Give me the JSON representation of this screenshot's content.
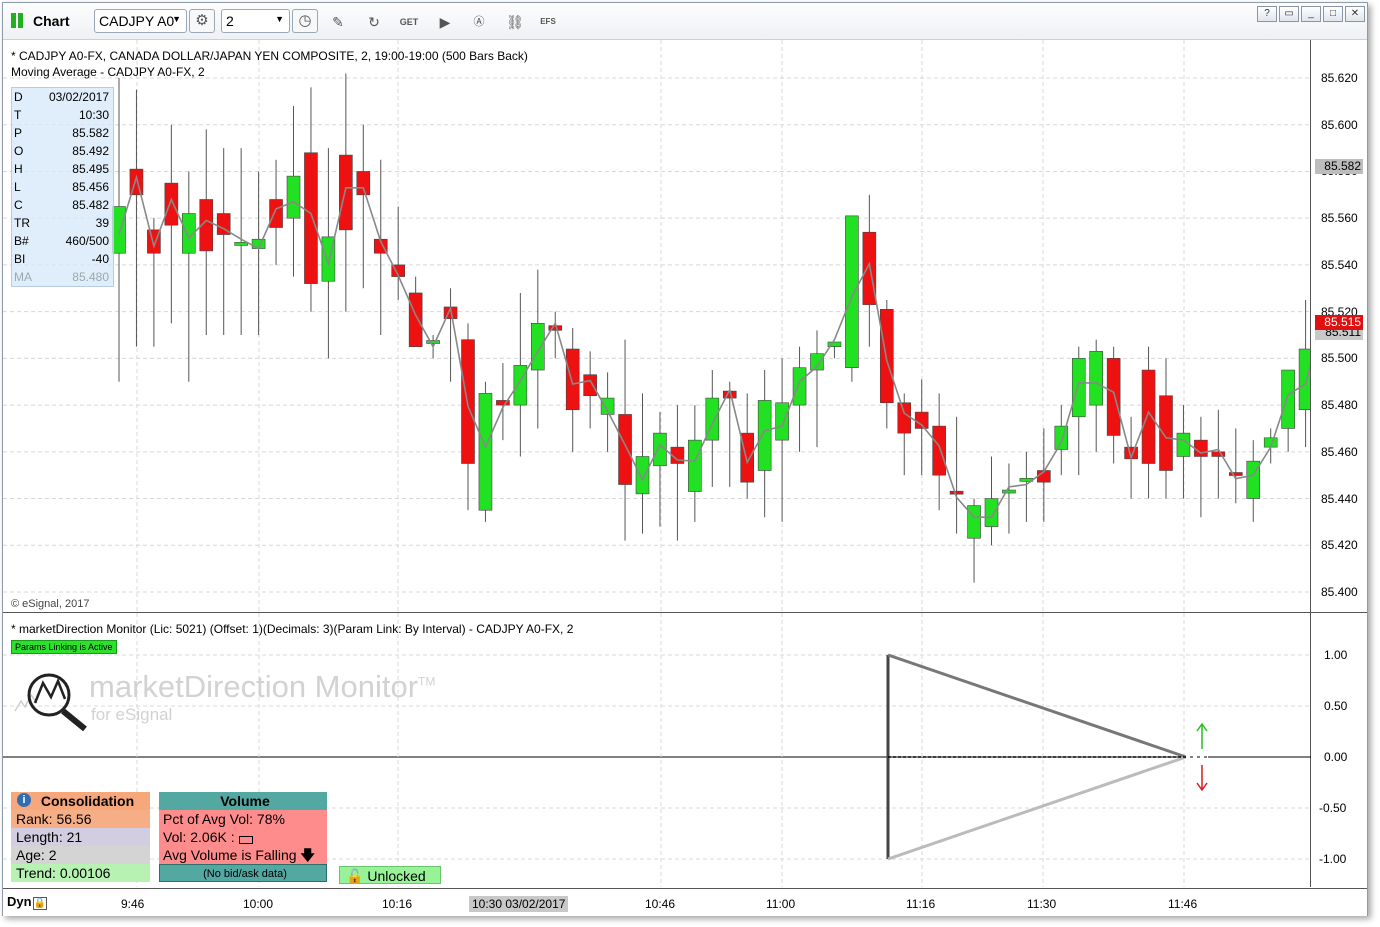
{
  "toolbar": {
    "title": "Chart",
    "symbol": "CADJPY A0",
    "interval": "2",
    "efs_label": "EFS",
    "icons": [
      "gear-icon",
      "clock-icon",
      "pencil-icon",
      "refresh-icon",
      "get-icon",
      "play-icon",
      "a-icon",
      "link-icon",
      "efs-icon"
    ]
  },
  "price_pane": {
    "legend_line1": "* CADJPY A0-FX, CANADA DOLLAR/JAPAN YEN COMPOSITE, 2, 19:00-19:00 (500 Bars Back)",
    "legend_line2": "Moving Average - CADJPY A0-FX, 2",
    "copyright": "© eSignal, 2017",
    "data_window": [
      {
        "k": "D",
        "v": "03/02/2017"
      },
      {
        "k": "T",
        "v": "10:30"
      },
      {
        "k": "P",
        "v": "85.582"
      },
      {
        "k": "O",
        "v": "85.492"
      },
      {
        "k": "H",
        "v": "85.495"
      },
      {
        "k": "L",
        "v": "85.456"
      },
      {
        "k": "C",
        "v": "85.482"
      },
      {
        "k": "TR",
        "v": "39"
      },
      {
        "k": "B#",
        "v": "460/500"
      },
      {
        "k": "BI",
        "v": "-40"
      },
      {
        "k": "MA",
        "v": "85.480"
      }
    ],
    "axis_ticks": [
      "85.620",
      "85.600",
      "85.580",
      "85.560",
      "85.540",
      "85.520",
      "85.500",
      "85.480",
      "85.460",
      "85.440",
      "85.420",
      "85.400"
    ],
    "last_price_label": "85.582",
    "ma_label": "85.515",
    "ma_label2": "85.511"
  },
  "indicator_pane": {
    "legend": "* marketDirection Monitor (Lic: 5021) (Offset: 1)(Decimals: 3)(Param Link: By Interval) - CADJPY A0-FX, 2",
    "params_badge": "Params Linking is Active",
    "logo_title": "marketDirection Monitor",
    "logo_tm": "TM",
    "logo_sub": "for eSignal",
    "axis_ticks": [
      "1.00",
      "0.50",
      "0.00",
      "-0.50",
      "-1.00"
    ],
    "consolidation": {
      "header": "Consolidation",
      "rank": "Rank: 56.56",
      "length": "Length: 21",
      "age": "Age: 2",
      "trend": "Trend: 0.00106"
    },
    "volume": {
      "header": "Volume",
      "pct": "Pct of Avg Vol: 78%",
      "vol": "Vol: 2.06K :",
      "avg": "Avg Volume is Falling",
      "note": "(No bid/ask data)"
    },
    "lock_label": "Unlocked"
  },
  "time_axis": {
    "dyn": "Dyn",
    "ticks": [
      "9:46",
      "10:00",
      "10:16",
      "10:46",
      "11:00",
      "11:16",
      "11:30",
      "11:46"
    ],
    "crosshair": "10:30 03/02/2017"
  },
  "colors": {
    "up": "#22e022",
    "down": "#ee1111",
    "ma": "#888888",
    "grid": "#d8d8d8"
  },
  "chart_data": {
    "type": "candlestick",
    "ylim": [
      85.395,
      85.635
    ],
    "candles": [
      {
        "o": 85.545,
        "h": 85.62,
        "l": 85.49,
        "c": 85.565
      },
      {
        "o": 85.581,
        "h": 85.615,
        "l": 85.505,
        "c": 85.57
      },
      {
        "o": 85.555,
        "h": 85.56,
        "l": 85.505,
        "c": 85.545
      },
      {
        "o": 85.575,
        "h": 85.6,
        "l": 85.515,
        "c": 85.557
      },
      {
        "o": 85.545,
        "h": 85.58,
        "l": 85.49,
        "c": 85.562
      },
      {
        "o": 85.568,
        "h": 85.598,
        "l": 85.51,
        "c": 85.546
      },
      {
        "o": 85.562,
        "h": 85.59,
        "l": 85.51,
        "c": 85.553
      },
      {
        "o": 85.549,
        "h": 85.59,
        "l": 85.51,
        "c": 85.549
      },
      {
        "o": 85.547,
        "h": 85.58,
        "l": 85.51,
        "c": 85.551
      },
      {
        "o": 85.568,
        "h": 85.585,
        "l": 85.54,
        "c": 85.556
      },
      {
        "o": 85.56,
        "h": 85.608,
        "l": 85.535,
        "c": 85.578
      },
      {
        "o": 85.588,
        "h": 85.616,
        "l": 85.52,
        "c": 85.532
      },
      {
        "o": 85.533,
        "h": 85.59,
        "l": 85.5,
        "c": 85.552
      },
      {
        "o": 85.587,
        "h": 85.622,
        "l": 85.52,
        "c": 85.555
      },
      {
        "o": 85.58,
        "h": 85.6,
        "l": 85.53,
        "c": 85.57
      },
      {
        "o": 85.551,
        "h": 85.585,
        "l": 85.51,
        "c": 85.545
      },
      {
        "o": 85.54,
        "h": 85.565,
        "l": 85.525,
        "c": 85.535
      },
      {
        "o": 85.528,
        "h": 85.535,
        "l": 85.51,
        "c": 85.505
      },
      {
        "o": 85.507,
        "h": 85.51,
        "l": 85.5,
        "c": 85.507
      },
      {
        "o": 85.522,
        "h": 85.53,
        "l": 85.49,
        "c": 85.517
      },
      {
        "o": 85.508,
        "h": 85.515,
        "l": 85.435,
        "c": 85.455
      },
      {
        "o": 85.435,
        "h": 85.49,
        "l": 85.43,
        "c": 85.485
      },
      {
        "o": 85.482,
        "h": 85.498,
        "l": 85.465,
        "c": 85.48
      },
      {
        "o": 85.48,
        "h": 85.528,
        "l": 85.458,
        "c": 85.497
      },
      {
        "o": 85.495,
        "h": 85.538,
        "l": 85.47,
        "c": 85.515
      },
      {
        "o": 85.514,
        "h": 85.52,
        "l": 85.5,
        "c": 85.512
      },
      {
        "o": 85.504,
        "h": 85.513,
        "l": 85.46,
        "c": 85.478
      },
      {
        "o": 85.493,
        "h": 85.503,
        "l": 85.47,
        "c": 85.484
      },
      {
        "o": 85.476,
        "h": 85.494,
        "l": 85.46,
        "c": 85.483
      },
      {
        "o": 85.476,
        "h": 85.508,
        "l": 85.422,
        "c": 85.446
      },
      {
        "o": 85.442,
        "h": 85.485,
        "l": 85.425,
        "c": 85.458
      },
      {
        "o": 85.454,
        "h": 85.477,
        "l": 85.428,
        "c": 85.468
      },
      {
        "o": 85.462,
        "h": 85.48,
        "l": 85.422,
        "c": 85.455
      },
      {
        "o": 85.443,
        "h": 85.48,
        "l": 85.43,
        "c": 85.465
      },
      {
        "o": 85.465,
        "h": 85.495,
        "l": 85.445,
        "c": 85.483
      },
      {
        "o": 85.486,
        "h": 85.49,
        "l": 85.445,
        "c": 85.483
      },
      {
        "o": 85.468,
        "h": 85.485,
        "l": 85.44,
        "c": 85.447
      },
      {
        "o": 85.452,
        "h": 85.495,
        "l": 85.432,
        "c": 85.482
      },
      {
        "o": 85.465,
        "h": 85.5,
        "l": 85.43,
        "c": 85.481
      },
      {
        "o": 85.48,
        "h": 85.505,
        "l": 85.46,
        "c": 85.496
      },
      {
        "o": 85.495,
        "h": 85.512,
        "l": 85.462,
        "c": 85.502
      },
      {
        "o": 85.505,
        "h": 85.507,
        "l": 85.5,
        "c": 85.507
      },
      {
        "o": 85.496,
        "h": 85.552,
        "l": 85.49,
        "c": 85.561
      },
      {
        "o": 85.554,
        "h": 85.57,
        "l": 85.505,
        "c": 85.523
      },
      {
        "o": 85.521,
        "h": 85.525,
        "l": 85.47,
        "c": 85.481
      },
      {
        "o": 85.481,
        "h": 85.485,
        "l": 85.45,
        "c": 85.468
      },
      {
        "o": 85.477,
        "h": 85.491,
        "l": 85.45,
        "c": 85.47
      },
      {
        "o": 85.471,
        "h": 85.485,
        "l": 85.435,
        "c": 85.45
      },
      {
        "o": 85.443,
        "h": 85.475,
        "l": 85.425,
        "c": 85.442
      },
      {
        "o": 85.423,
        "h": 85.44,
        "l": 85.404,
        "c": 85.437
      },
      {
        "o": 85.428,
        "h": 85.458,
        "l": 85.42,
        "c": 85.44
      },
      {
        "o": 85.443,
        "h": 85.455,
        "l": 85.425,
        "c": 85.443
      },
      {
        "o": 85.448,
        "h": 85.46,
        "l": 85.43,
        "c": 85.448
      },
      {
        "o": 85.452,
        "h": 85.47,
        "l": 85.43,
        "c": 85.447
      },
      {
        "o": 85.461,
        "h": 85.48,
        "l": 85.45,
        "c": 85.471
      },
      {
        "o": 85.475,
        "h": 85.505,
        "l": 85.45,
        "c": 85.5
      },
      {
        "o": 85.48,
        "h": 85.508,
        "l": 85.46,
        "c": 85.503
      },
      {
        "o": 85.5,
        "h": 85.505,
        "l": 85.455,
        "c": 85.467
      },
      {
        "o": 85.462,
        "h": 85.475,
        "l": 85.44,
        "c": 85.457
      },
      {
        "o": 85.495,
        "h": 85.505,
        "l": 85.44,
        "c": 85.455
      },
      {
        "o": 85.484,
        "h": 85.5,
        "l": 85.44,
        "c": 85.452
      },
      {
        "o": 85.458,
        "h": 85.48,
        "l": 85.44,
        "c": 85.468
      },
      {
        "o": 85.465,
        "h": 85.475,
        "l": 85.432,
        "c": 85.458
      },
      {
        "o": 85.46,
        "h": 85.478,
        "l": 85.44,
        "c": 85.458
      },
      {
        "o": 85.451,
        "h": 85.47,
        "l": 85.438,
        "c": 85.45
      },
      {
        "o": 85.44,
        "h": 85.465,
        "l": 85.43,
        "c": 85.456
      },
      {
        "o": 85.462,
        "h": 85.47,
        "l": 85.455,
        "c": 85.466
      },
      {
        "o": 85.47,
        "h": 85.495,
        "l": 85.46,
        "c": 85.495
      },
      {
        "o": 85.478,
        "h": 85.525,
        "l": 85.462,
        "c": 85.504
      },
      {
        "o": 85.518,
        "h": 85.535,
        "l": 85.495,
        "c": 85.514
      }
    ]
  }
}
